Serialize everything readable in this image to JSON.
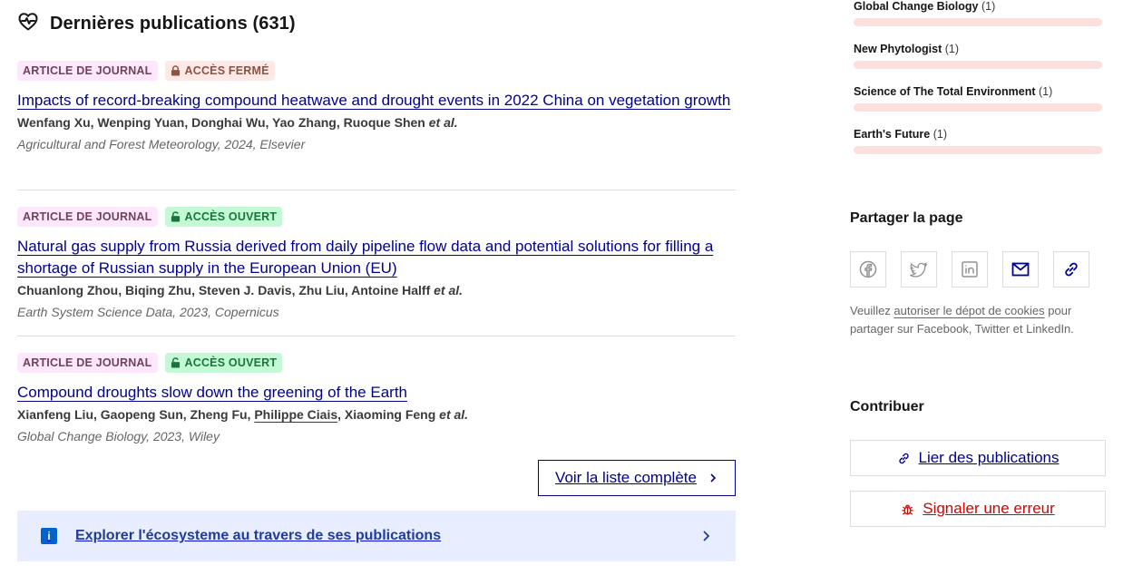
{
  "section": {
    "title": "Dernières publications (631)",
    "icon": "heart-pulse-icon"
  },
  "publications": [
    {
      "type_badge": "ARTICLE DE JOURNAL",
      "access_badge": "ACCÈS FERMÉ",
      "access": "closed",
      "title": "Impacts of record-breaking compound heatwave and drought events in 2022 China on vegetation growth",
      "authors": "Wenfang Xu, Wenping Yuan, Donghai Wu, Yao Zhang, Ruoque Shen",
      "et_al": "et al.",
      "source": "Agricultural and Forest Meteorology, 2024, Elsevier"
    },
    {
      "type_badge": "ARTICLE DE JOURNAL",
      "access_badge": "ACCÈS OUVERT",
      "access": "open",
      "title": "Natural gas supply from Russia derived from daily pipeline flow data and potential solutions for filling a shortage of Russian supply in the European Union (EU)",
      "authors": "Chuanlong Zhou, Biqing Zhu, Steven J. Davis, Zhu Liu, Antoine Halff",
      "et_al": "et al.",
      "source": "Earth System Science Data, 2023, Copernicus"
    },
    {
      "type_badge": "ARTICLE DE JOURNAL",
      "access_badge": "ACCÈS OUVERT",
      "access": "open",
      "title": "Compound droughts slow down the greening of the Earth",
      "authors_before": "Xianfeng Liu, Gaopeng Sun, Zheng Fu, ",
      "authors_linked": "Philippe Ciais",
      "authors_after": ", Xiaoming Feng",
      "et_al": "et al.",
      "source": "Global Change Biology, 2023, Wiley"
    }
  ],
  "see_all_label": "Voir la liste complète",
  "explore_label": "Explorer l'écosysteme au travers de ses publications",
  "journals": [
    {
      "name": "Global Change Biology",
      "count": "(1)"
    },
    {
      "name": "New Phytologist",
      "count": "(1)"
    },
    {
      "name": "Science of The Total Environment",
      "count": "(1)"
    },
    {
      "name": "Earth's Future",
      "count": "(1)"
    }
  ],
  "share": {
    "title": "Partager la page",
    "buttons": [
      "facebook-icon",
      "twitter-icon",
      "linkedin-icon",
      "mail-icon",
      "link-icon"
    ],
    "note_before": "Veuillez ",
    "note_link": "autoriser le dépot de cookies",
    "note_after": " pour partager sur Facebook, Twitter et LinkedIn."
  },
  "contribute": {
    "title": "Contribuer",
    "link_label": "Lier des publications",
    "report_label": "Signaler une erreur"
  },
  "colors": {
    "primary": "#000091",
    "error": "#ce0500",
    "badge_type_bg": "#fee7fc",
    "badge_closed_bg": "#fee9e7",
    "badge_open_bg": "#c3fad5",
    "explore_bg": "#e8edff",
    "journal_bar": "#fde0dd"
  }
}
